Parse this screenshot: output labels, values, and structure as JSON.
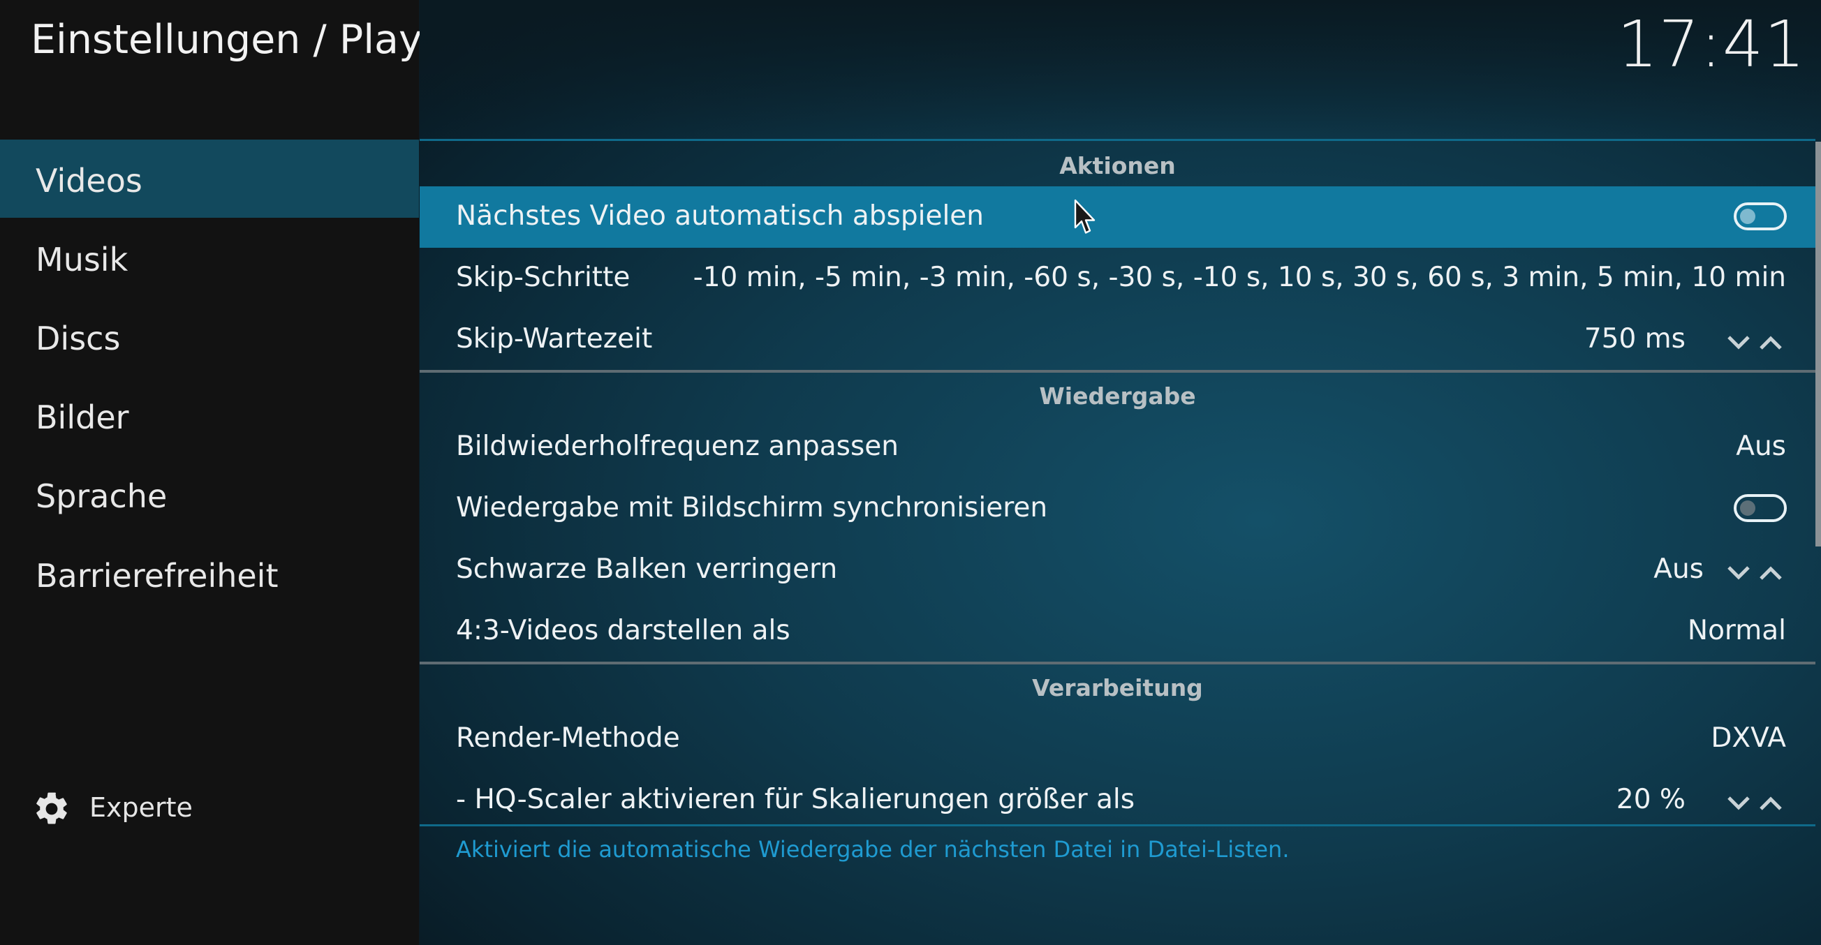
{
  "header": {
    "title": "Einstellungen / Player",
    "clock": "17:41"
  },
  "sidebar": {
    "items": [
      {
        "label": "Videos",
        "active": true
      },
      {
        "label": "Musik"
      },
      {
        "label": "Discs"
      },
      {
        "label": "Bilder"
      },
      {
        "label": "Sprache"
      },
      {
        "label": "Barrierefreiheit"
      }
    ],
    "expert": {
      "label": "Experte",
      "icon": "gear-icon"
    }
  },
  "sections": {
    "aktionen": "Aktionen",
    "wiedergabe": "Wiedergabe",
    "verarbeitung": "Verarbeitung"
  },
  "settings": {
    "next_video": {
      "label": "Nächstes Video automatisch abspielen",
      "enabled": false
    },
    "skip_steps": {
      "label": "Skip-Schritte",
      "value": "-10 min, -5 min, -3 min, -60 s, -30 s, -10 s, 10 s, 30 s, 60 s, 3 min, 5 min, 10 min"
    },
    "skip_delay": {
      "label": "Skip-Wartezeit",
      "value": "750 ms"
    },
    "refresh_rate": {
      "label": "Bildwiederholfrequenz anpassen",
      "value": "Aus"
    },
    "sync_display": {
      "label": "Wiedergabe mit Bildschirm synchronisieren",
      "enabled": false
    },
    "black_bars": {
      "label": "Schwarze Balken verringern",
      "value": "Aus"
    },
    "display_43": {
      "label": "4:3-Videos darstellen als",
      "value": "Normal"
    },
    "render_method": {
      "label": "Render-Methode",
      "value": "DXVA"
    },
    "hq_scaler": {
      "label": "- HQ-Scaler aktivieren für Skalierungen größer als",
      "value": "20 %"
    }
  },
  "description": "Aktiviert die automatische Wiedergabe der nächsten Datei in Datei-Listen.",
  "colors": {
    "focus": "#11799f",
    "accent_line": "#0f6a8a",
    "description_text": "#1f9bd1",
    "sidebar_active": "#12495d"
  }
}
